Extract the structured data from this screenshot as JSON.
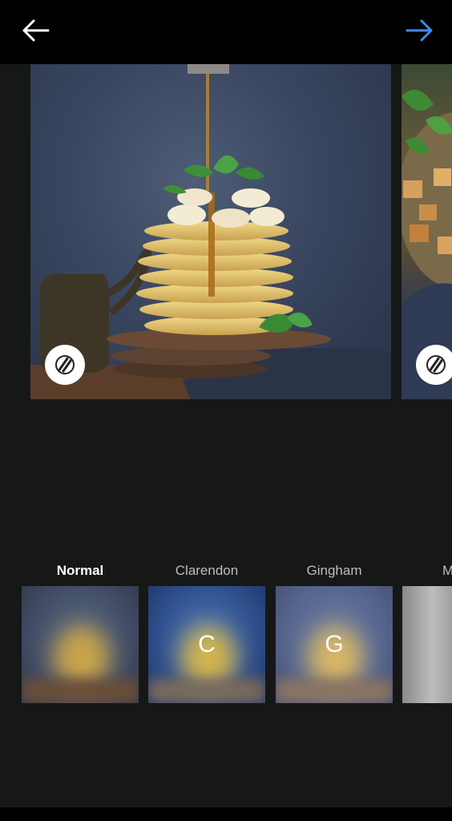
{
  "topbar": {
    "back_icon": "arrow-left-icon",
    "next_icon": "arrow-right-icon",
    "back_color": "#ffffff",
    "next_color": "#3f8be8"
  },
  "preview": {
    "adjust_icon": "lux-adjust-icon"
  },
  "filters": [
    {
      "label": "Normal",
      "letter": "",
      "selected": true
    },
    {
      "label": "Clarendon",
      "letter": "C",
      "selected": false
    },
    {
      "label": "Gingham",
      "letter": "G",
      "selected": false
    },
    {
      "label": "M",
      "letter": "",
      "selected": false
    }
  ],
  "colors": {
    "background": "#161817",
    "topbar": "#000000"
  }
}
